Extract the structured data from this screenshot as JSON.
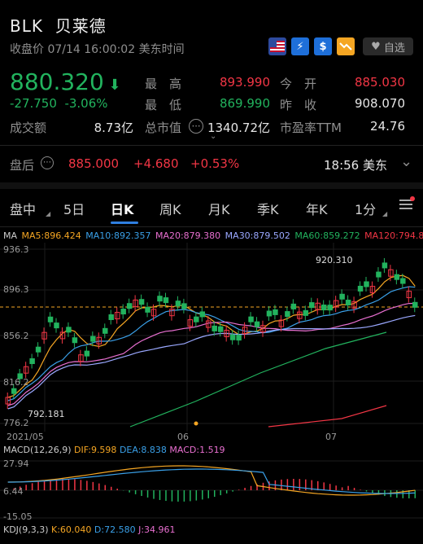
{
  "header": {
    "symbol": "BLK",
    "name": "贝莱德",
    "status": "收盘价 07/14 16:00:02 美东时间",
    "fav_label": "自选"
  },
  "quote": {
    "price": "880.320",
    "change": "-27.750",
    "change_pct": "-3.06%",
    "stats": [
      {
        "label": "最　高",
        "value": "893.990",
        "label2": "今　开",
        "value2": "885.030"
      },
      {
        "label": "最　低",
        "value": "869.990",
        "label2": "昨　收",
        "value2": "908.070"
      }
    ],
    "volume_label": "成交额",
    "volume": "8.73亿",
    "mcap_label": "总市值",
    "mcap": "1340.72亿",
    "pe_label": "市盈率TTM",
    "pe": "24.76"
  },
  "after_hours": {
    "label": "盘后",
    "price": "885.000",
    "change": "+4.680",
    "change_pct": "+0.53%",
    "time": "18:56 美东"
  },
  "tabs": [
    "盘中",
    "5日",
    "日K",
    "周K",
    "月K",
    "季K",
    "年K",
    "1分"
  ],
  "ma_legend": {
    "ma": "MA",
    "ma5": "MA5:896.424",
    "ma10": "MA10:892.357",
    "ma20": "MA20:879.380",
    "ma30": "MA30:879.502",
    "ma60": "MA60:859.272",
    "ma120": "MA120:794.8"
  },
  "colors": {
    "ma5": "#f5a623",
    "ma10": "#3aa0e8",
    "ma20": "#e86fd0",
    "ma30": "#9aa8ff",
    "ma60": "#22b35e",
    "ma120": "#f23645",
    "up": "#f23645",
    "down": "#22b35e"
  },
  "price_axis": [
    "936.3",
    "896.3",
    "856.2",
    "816.2",
    "776.2"
  ],
  "annotations": {
    "high": "920.310",
    "low": "792.181"
  },
  "date_axis": [
    "2021/05",
    "06",
    "07"
  ],
  "macd": {
    "title": "MACD(12,26,9)",
    "dif": "DIF:9.598",
    "dea": "DEA:8.838",
    "macd": "MACD:1.519",
    "axis": [
      "27.94",
      "6.44",
      "-15.05"
    ]
  },
  "kdj": {
    "title": "KDJ(9,3,3)",
    "k": "K:60.040",
    "d": "D:72.580",
    "j": "J:34.961"
  }
}
